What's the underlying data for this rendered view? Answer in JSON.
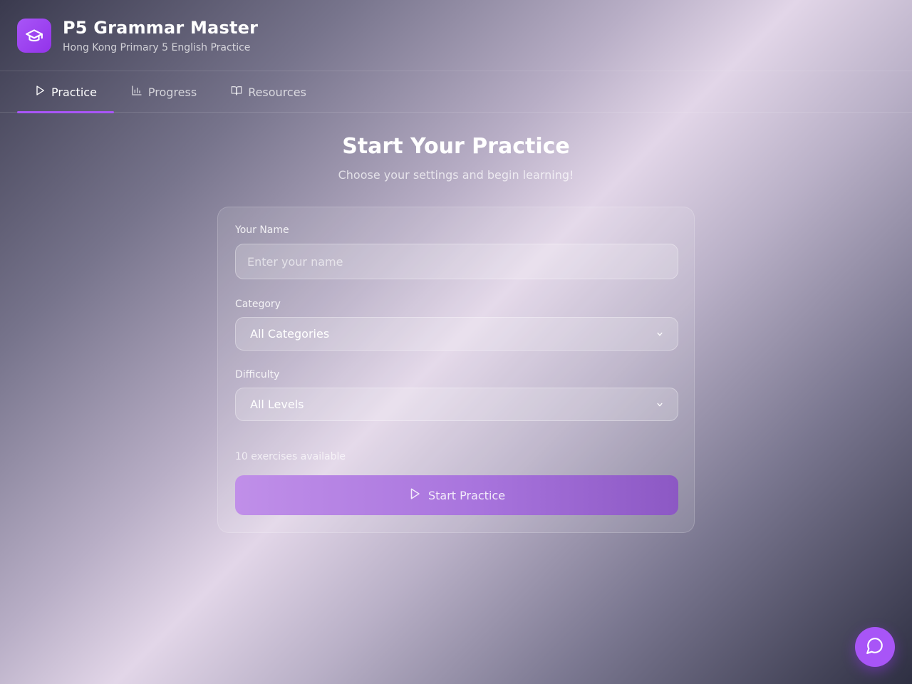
{
  "app": {
    "title": "P5 Grammar Master",
    "subtitle": "Hong Kong Primary 5 English Practice",
    "logo_icon": "graduation-cap-icon"
  },
  "tabs": [
    {
      "label": "Practice",
      "icon": "play-icon",
      "active": true
    },
    {
      "label": "Progress",
      "icon": "bar-chart-icon",
      "active": false
    },
    {
      "label": "Resources",
      "icon": "book-open-icon",
      "active": false
    }
  ],
  "hero": {
    "title": "Start Your Practice",
    "subtitle": "Choose your settings and begin learning!"
  },
  "form": {
    "name_label": "Your Name",
    "name_placeholder": "Enter your name",
    "name_value": "",
    "category_label": "Category",
    "category_selected": "All Categories",
    "difficulty_label": "Difficulty",
    "difficulty_selected": "All Levels",
    "exercise_count": "10 exercises available",
    "start_label": "Start Practice"
  },
  "chat": {
    "icon": "chat-bubble-icon"
  },
  "colors": {
    "accent": "#a855f7",
    "accent_dark": "#9333ea"
  }
}
